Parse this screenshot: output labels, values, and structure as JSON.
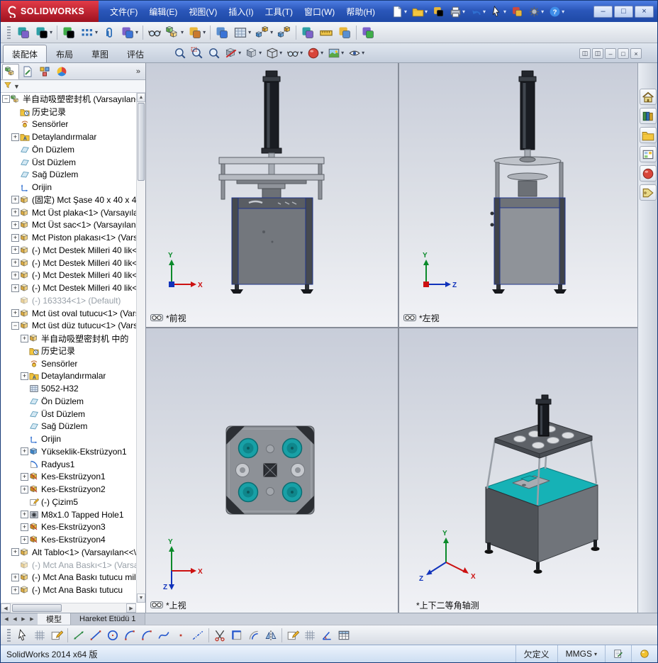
{
  "titlebar": {
    "app_name": "SOLIDWORKS",
    "menus": [
      "文件(F)",
      "编辑(E)",
      "视图(V)",
      "插入(I)",
      "工具(T)",
      "窗口(W)",
      "帮助(H)"
    ],
    "quick_icons": [
      {
        "name": "new-document-icon",
        "dropdown": true
      },
      {
        "name": "open-icon",
        "dropdown": true
      },
      {
        "name": "publish-edrawings-icon",
        "dropdown": false
      },
      {
        "name": "print-icon",
        "dropdown": true
      },
      {
        "name": "undo-icon",
        "dropdown": true
      },
      {
        "name": "select-arrow-icon",
        "dropdown": true
      },
      {
        "name": "toolbox-icon",
        "dropdown": false
      },
      {
        "name": "options-icon",
        "dropdown": true
      },
      {
        "name": "help-icon",
        "dropdown": true
      }
    ],
    "window_controls": [
      {
        "name": "minimize-button",
        "glyph": "–"
      },
      {
        "name": "maximize-button",
        "glyph": "□"
      },
      {
        "name": "close-button",
        "glyph": "×"
      }
    ]
  },
  "assembly_toolbar": [
    {
      "name": "edit-component-icon"
    },
    {
      "name": "insert-components-icon",
      "dropdown": true
    },
    {
      "name": "smart-fasteners-icon",
      "sep": true
    },
    {
      "name": "linear-component-pattern-icon",
      "dropdown": true
    },
    {
      "name": "mate-icon"
    },
    {
      "name": "move-component-icon",
      "dropdown": true
    },
    {
      "name": "show-hidden-components-icon",
      "sep": true
    },
    {
      "name": "assembly-features-icon",
      "dropdown": true
    },
    {
      "name": "reference-geometry-icon",
      "dropdown": true
    },
    {
      "name": "new-motion-study-icon",
      "sep": true
    },
    {
      "name": "bill-of-materials-icon",
      "dropdown": true
    },
    {
      "name": "exploded-view-icon",
      "dropdown": true
    },
    {
      "name": "explode-line-sketch-icon"
    },
    {
      "name": "interference-detection-icon",
      "sep": true
    },
    {
      "name": "measure-icon"
    },
    {
      "name": "mass-properties-icon"
    },
    {
      "name": "performance-evaluation-icon",
      "sep": true
    }
  ],
  "command_tabs": [
    {
      "label": "装配体",
      "active": true
    },
    {
      "label": "布局",
      "active": false
    },
    {
      "label": "草图",
      "active": false
    },
    {
      "label": "评估",
      "active": false
    }
  ],
  "view_toolbar": [
    {
      "name": "zoom-fit-icon"
    },
    {
      "name": "zoom-area-icon"
    },
    {
      "name": "previous-view-icon"
    },
    {
      "name": "section-view-icon",
      "dropdown": true
    },
    {
      "name": "view-orientation-icon",
      "dropdown": true
    },
    {
      "name": "display-style-icon",
      "dropdown": true
    },
    {
      "name": "hide-show-items-icon",
      "dropdown": true
    },
    {
      "name": "edit-appearance-icon",
      "dropdown": true
    },
    {
      "name": "apply-scene-icon",
      "dropdown": true
    },
    {
      "name": "view-settings-icon",
      "dropdown": true
    }
  ],
  "doc_window_controls": [
    {
      "name": "doc-split-button",
      "glyph": "◫"
    },
    {
      "name": "doc-tile-button",
      "glyph": "◫"
    },
    {
      "name": "doc-minimize-button",
      "glyph": "–"
    },
    {
      "name": "doc-restore-button",
      "glyph": "□"
    },
    {
      "name": "doc-close-button",
      "glyph": "×"
    }
  ],
  "feature_tree": {
    "panel_tabs": [
      {
        "name": "featuremanager-tab-icon",
        "active": true
      },
      {
        "name": "propertymanager-tab-icon",
        "active": false
      },
      {
        "name": "configurationmanager-tab-icon",
        "active": false
      },
      {
        "name": "displaymanager-tab-icon",
        "active": false
      }
    ],
    "overflow_label": "»",
    "filter_arrow": "▼",
    "items": [
      {
        "label": "半自动吸塑密封机 (Varsayılan<",
        "icon": "assembly",
        "depth": 0,
        "expand": "minus"
      },
      {
        "label": "历史记录",
        "icon": "history",
        "depth": 1
      },
      {
        "label": "Sensörler",
        "icon": "sensor",
        "depth": 1
      },
      {
        "label": "Detaylandırmalar",
        "icon": "annotations",
        "depth": 1,
        "expand": "plus"
      },
      {
        "label": "Ön Düzlem",
        "icon": "plane",
        "depth": 1
      },
      {
        "label": "Üst Düzlem",
        "icon": "plane",
        "depth": 1
      },
      {
        "label": "Sağ Düzlem",
        "icon": "plane",
        "depth": 1
      },
      {
        "label": "Orijin",
        "icon": "origin",
        "depth": 1
      },
      {
        "label": "(固定) Mct Şase 40 x 40 x 4<",
        "icon": "part",
        "depth": 1,
        "expand": "plus"
      },
      {
        "label": "Mct Üst plaka<1> (Varsayılar",
        "icon": "part",
        "depth": 1,
        "expand": "plus"
      },
      {
        "label": "Mct Üst sac<1> (Varsayılan<",
        "icon": "part",
        "depth": 1,
        "expand": "plus"
      },
      {
        "label": "Mct Piston plakası<1> (Varsa",
        "icon": "part",
        "depth": 1,
        "expand": "plus"
      },
      {
        "label": "(-) Mct Destek Milleri 40 lik<1",
        "icon": "part",
        "depth": 1,
        "expand": "plus"
      },
      {
        "label": "(-) Mct Destek Milleri 40 lik<2",
        "icon": "part",
        "depth": 1,
        "expand": "plus"
      },
      {
        "label": "(-) Mct Destek Milleri 40 lik<3",
        "icon": "part",
        "depth": 1,
        "expand": "plus"
      },
      {
        "label": "(-) Mct Destek Milleri 40 lik<4",
        "icon": "part",
        "depth": 1,
        "expand": "plus"
      },
      {
        "label": "(-) 163334<1> (Default)",
        "icon": "part",
        "depth": 1,
        "gray": true
      },
      {
        "label": "Mct üst oval tutucu<1> (Vars",
        "icon": "part",
        "depth": 1,
        "expand": "plus"
      },
      {
        "label": "Mct üst düz tutucu<1> (Vars",
        "icon": "part",
        "depth": 1,
        "expand": "minus"
      },
      {
        "label": "半自动吸塑密封机 中的",
        "icon": "part",
        "depth": 2,
        "expand": "plus"
      },
      {
        "label": "历史记录",
        "icon": "history",
        "depth": 2
      },
      {
        "label": "Sensörler",
        "icon": "sensor",
        "depth": 2
      },
      {
        "label": "Detaylandırmalar",
        "icon": "annotations",
        "depth": 2,
        "expand": "plus"
      },
      {
        "label": "5052-H32",
        "icon": "material",
        "depth": 2
      },
      {
        "label": "Ön Düzlem",
        "icon": "plane",
        "depth": 2
      },
      {
        "label": "Üst Düzlem",
        "icon": "plane",
        "depth": 2
      },
      {
        "label": "Sağ Düzlem",
        "icon": "plane",
        "depth": 2
      },
      {
        "label": "Orijin",
        "icon": "origin",
        "depth": 2
      },
      {
        "label": "Yükseklik-Ekstrüzyon1",
        "icon": "extrude",
        "depth": 2,
        "expand": "plus"
      },
      {
        "label": "Radyus1",
        "icon": "fillet",
        "depth": 2
      },
      {
        "label": "Kes-Ekstrüzyon1",
        "icon": "cut",
        "depth": 2,
        "expand": "plus"
      },
      {
        "label": "Kes-Ekstrüzyon2",
        "icon": "cut",
        "depth": 2,
        "expand": "plus"
      },
      {
        "label": "(-) Çizim5",
        "icon": "sketch",
        "depth": 2
      },
      {
        "label": "M8x1.0 Tapped Hole1",
        "icon": "hole",
        "depth": 2,
        "expand": "plus"
      },
      {
        "label": "Kes-Ekstrüzyon3",
        "icon": "cut",
        "depth": 2,
        "expand": "plus"
      },
      {
        "label": "Kes-Ekstrüzyon4",
        "icon": "cut",
        "depth": 2,
        "expand": "plus"
      },
      {
        "label": "Alt Tablo<1> (Varsayılan<<\\",
        "icon": "part",
        "depth": 1,
        "expand": "plus"
      },
      {
        "label": "(-) Mct Ana Baskı<1> (Varsa",
        "icon": "part",
        "depth": 1,
        "gray": true
      },
      {
        "label": "(-) Mct Ana Baskı tutucu mil<",
        "icon": "part",
        "depth": 1,
        "expand": "plus"
      },
      {
        "label": "(-) Mct Ana Baskı tutucu",
        "icon": "part",
        "depth": 1,
        "expand": "plus"
      }
    ]
  },
  "viewport": {
    "views": [
      {
        "label": "*前视",
        "has_icon": true
      },
      {
        "label": "*左视",
        "has_icon": true
      },
      {
        "label": "*上视",
        "has_icon": true
      },
      {
        "label": "*上下二等角轴测",
        "has_icon": false
      }
    ],
    "accent_teal": "#17a3a8",
    "cabinet_gray": "#73777d"
  },
  "task_pane": [
    {
      "name": "resources-home-icon"
    },
    {
      "name": "design-library-icon"
    },
    {
      "name": "file-explorer-icon"
    },
    {
      "name": "view-palette-icon"
    },
    {
      "name": "appearances-scenes-icon"
    },
    {
      "name": "custom-properties-icon"
    }
  ],
  "bottom_bar": {
    "nav_glyphs": [
      "◀",
      "◀",
      "▶",
      "▶"
    ],
    "tabs": [
      {
        "label": "模型",
        "active": true
      },
      {
        "label": "Hareket Etüdü 1",
        "active": false
      }
    ]
  },
  "sketch_toolbar": [
    {
      "name": "select-icon"
    },
    {
      "name": "grid-snap-icon"
    },
    {
      "name": "sketch-icon"
    },
    {
      "name": "smart-dimension-icon",
      "sep": true
    },
    {
      "name": "line-icon"
    },
    {
      "name": "circle-icon"
    },
    {
      "name": "centerpoint-arc-icon"
    },
    {
      "name": "tangent-arc-icon"
    },
    {
      "name": "spline-icon"
    },
    {
      "name": "point-icon"
    },
    {
      "name": "centerline-icon"
    },
    {
      "name": "trim-entities-icon",
      "sep": true
    },
    {
      "name": "convert-entities-icon"
    },
    {
      "name": "offset-entities-icon"
    },
    {
      "name": "mirror-entities-icon"
    },
    {
      "name": "linear-sketch-pattern-icon",
      "sep": true
    },
    {
      "name": "display-grid-icon"
    },
    {
      "name": "angle-icon"
    },
    {
      "name": "table-icon"
    }
  ],
  "status_bar": {
    "left_text": "SolidWorks 2014 x64 版",
    "definition_state": "欠定义",
    "units": "MMGS",
    "units_dropdown": "▾"
  }
}
